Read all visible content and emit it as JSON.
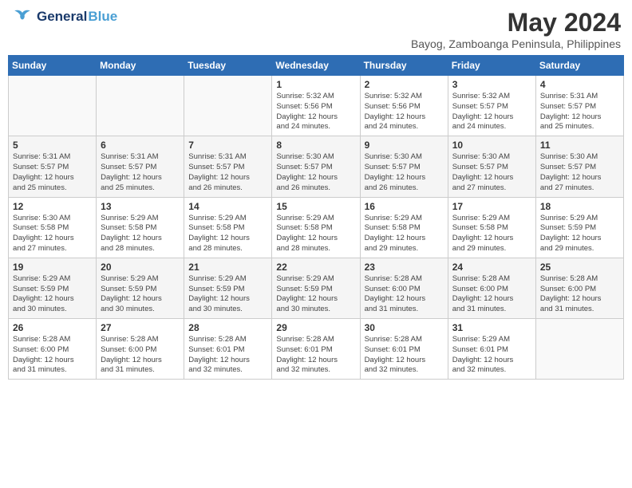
{
  "header": {
    "logo_line1": "General",
    "logo_line2": "Blue",
    "title": "May 2024",
    "subtitle": "Bayog, Zamboanga Peninsula, Philippines"
  },
  "weekdays": [
    "Sunday",
    "Monday",
    "Tuesday",
    "Wednesday",
    "Thursday",
    "Friday",
    "Saturday"
  ],
  "weeks": [
    [
      {
        "day": "",
        "info": ""
      },
      {
        "day": "",
        "info": ""
      },
      {
        "day": "",
        "info": ""
      },
      {
        "day": "1",
        "info": "Sunrise: 5:32 AM\nSunset: 5:56 PM\nDaylight: 12 hours\nand 24 minutes."
      },
      {
        "day": "2",
        "info": "Sunrise: 5:32 AM\nSunset: 5:56 PM\nDaylight: 12 hours\nand 24 minutes."
      },
      {
        "day": "3",
        "info": "Sunrise: 5:32 AM\nSunset: 5:57 PM\nDaylight: 12 hours\nand 24 minutes."
      },
      {
        "day": "4",
        "info": "Sunrise: 5:31 AM\nSunset: 5:57 PM\nDaylight: 12 hours\nand 25 minutes."
      }
    ],
    [
      {
        "day": "5",
        "info": "Sunrise: 5:31 AM\nSunset: 5:57 PM\nDaylight: 12 hours\nand 25 minutes."
      },
      {
        "day": "6",
        "info": "Sunrise: 5:31 AM\nSunset: 5:57 PM\nDaylight: 12 hours\nand 25 minutes."
      },
      {
        "day": "7",
        "info": "Sunrise: 5:31 AM\nSunset: 5:57 PM\nDaylight: 12 hours\nand 26 minutes."
      },
      {
        "day": "8",
        "info": "Sunrise: 5:30 AM\nSunset: 5:57 PM\nDaylight: 12 hours\nand 26 minutes."
      },
      {
        "day": "9",
        "info": "Sunrise: 5:30 AM\nSunset: 5:57 PM\nDaylight: 12 hours\nand 26 minutes."
      },
      {
        "day": "10",
        "info": "Sunrise: 5:30 AM\nSunset: 5:57 PM\nDaylight: 12 hours\nand 27 minutes."
      },
      {
        "day": "11",
        "info": "Sunrise: 5:30 AM\nSunset: 5:57 PM\nDaylight: 12 hours\nand 27 minutes."
      }
    ],
    [
      {
        "day": "12",
        "info": "Sunrise: 5:30 AM\nSunset: 5:58 PM\nDaylight: 12 hours\nand 27 minutes."
      },
      {
        "day": "13",
        "info": "Sunrise: 5:29 AM\nSunset: 5:58 PM\nDaylight: 12 hours\nand 28 minutes."
      },
      {
        "day": "14",
        "info": "Sunrise: 5:29 AM\nSunset: 5:58 PM\nDaylight: 12 hours\nand 28 minutes."
      },
      {
        "day": "15",
        "info": "Sunrise: 5:29 AM\nSunset: 5:58 PM\nDaylight: 12 hours\nand 28 minutes."
      },
      {
        "day": "16",
        "info": "Sunrise: 5:29 AM\nSunset: 5:58 PM\nDaylight: 12 hours\nand 29 minutes."
      },
      {
        "day": "17",
        "info": "Sunrise: 5:29 AM\nSunset: 5:58 PM\nDaylight: 12 hours\nand 29 minutes."
      },
      {
        "day": "18",
        "info": "Sunrise: 5:29 AM\nSunset: 5:59 PM\nDaylight: 12 hours\nand 29 minutes."
      }
    ],
    [
      {
        "day": "19",
        "info": "Sunrise: 5:29 AM\nSunset: 5:59 PM\nDaylight: 12 hours\nand 30 minutes."
      },
      {
        "day": "20",
        "info": "Sunrise: 5:29 AM\nSunset: 5:59 PM\nDaylight: 12 hours\nand 30 minutes."
      },
      {
        "day": "21",
        "info": "Sunrise: 5:29 AM\nSunset: 5:59 PM\nDaylight: 12 hours\nand 30 minutes."
      },
      {
        "day": "22",
        "info": "Sunrise: 5:29 AM\nSunset: 5:59 PM\nDaylight: 12 hours\nand 30 minutes."
      },
      {
        "day": "23",
        "info": "Sunrise: 5:28 AM\nSunset: 6:00 PM\nDaylight: 12 hours\nand 31 minutes."
      },
      {
        "day": "24",
        "info": "Sunrise: 5:28 AM\nSunset: 6:00 PM\nDaylight: 12 hours\nand 31 minutes."
      },
      {
        "day": "25",
        "info": "Sunrise: 5:28 AM\nSunset: 6:00 PM\nDaylight: 12 hours\nand 31 minutes."
      }
    ],
    [
      {
        "day": "26",
        "info": "Sunrise: 5:28 AM\nSunset: 6:00 PM\nDaylight: 12 hours\nand 31 minutes."
      },
      {
        "day": "27",
        "info": "Sunrise: 5:28 AM\nSunset: 6:00 PM\nDaylight: 12 hours\nand 31 minutes."
      },
      {
        "day": "28",
        "info": "Sunrise: 5:28 AM\nSunset: 6:01 PM\nDaylight: 12 hours\nand 32 minutes."
      },
      {
        "day": "29",
        "info": "Sunrise: 5:28 AM\nSunset: 6:01 PM\nDaylight: 12 hours\nand 32 minutes."
      },
      {
        "day": "30",
        "info": "Sunrise: 5:28 AM\nSunset: 6:01 PM\nDaylight: 12 hours\nand 32 minutes."
      },
      {
        "day": "31",
        "info": "Sunrise: 5:29 AM\nSunset: 6:01 PM\nDaylight: 12 hours\nand 32 minutes."
      },
      {
        "day": "",
        "info": ""
      }
    ]
  ]
}
